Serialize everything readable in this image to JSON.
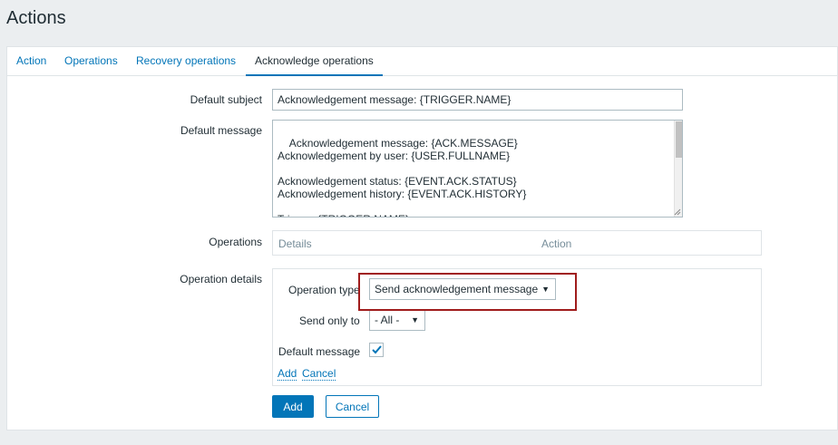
{
  "page": {
    "title": "Actions"
  },
  "tabs": [
    {
      "label": "Action",
      "active": false
    },
    {
      "label": "Operations",
      "active": false
    },
    {
      "label": "Recovery operations",
      "active": false
    },
    {
      "label": "Acknowledge operations",
      "active": true
    }
  ],
  "form": {
    "default_subject": {
      "label": "Default subject",
      "value": "Acknowledgement message: {TRIGGER.NAME}"
    },
    "default_message": {
      "label": "Default message",
      "value": "Acknowledgement message: {ACK.MESSAGE}\nAcknowledgement by user: {USER.FULLNAME}\n\nAcknowledgement status: {EVENT.ACK.STATUS}\nAcknowledgement history: {EVENT.ACK.HISTORY}\n\nTrigger: {TRIGGER.NAME}\nTrigger status: {TRIGGER.STATUS}"
    },
    "operations": {
      "label": "Operations",
      "columns": [
        "Details",
        "Action"
      ]
    },
    "operation_details": {
      "label": "Operation details",
      "operation_type_label": "Operation type",
      "operation_type_value": "Send acknowledgement message",
      "send_only_to_label": "Send only to",
      "send_only_to_value": "- All -",
      "default_message_label": "Default message",
      "default_message_checked": true,
      "add_link": "Add",
      "cancel_link": "Cancel"
    },
    "buttons": {
      "add": "Add",
      "cancel": "Cancel"
    }
  },
  "colors": {
    "accent": "#0275b8",
    "highlight": "#a01c1c",
    "background": "#ebeef0"
  }
}
